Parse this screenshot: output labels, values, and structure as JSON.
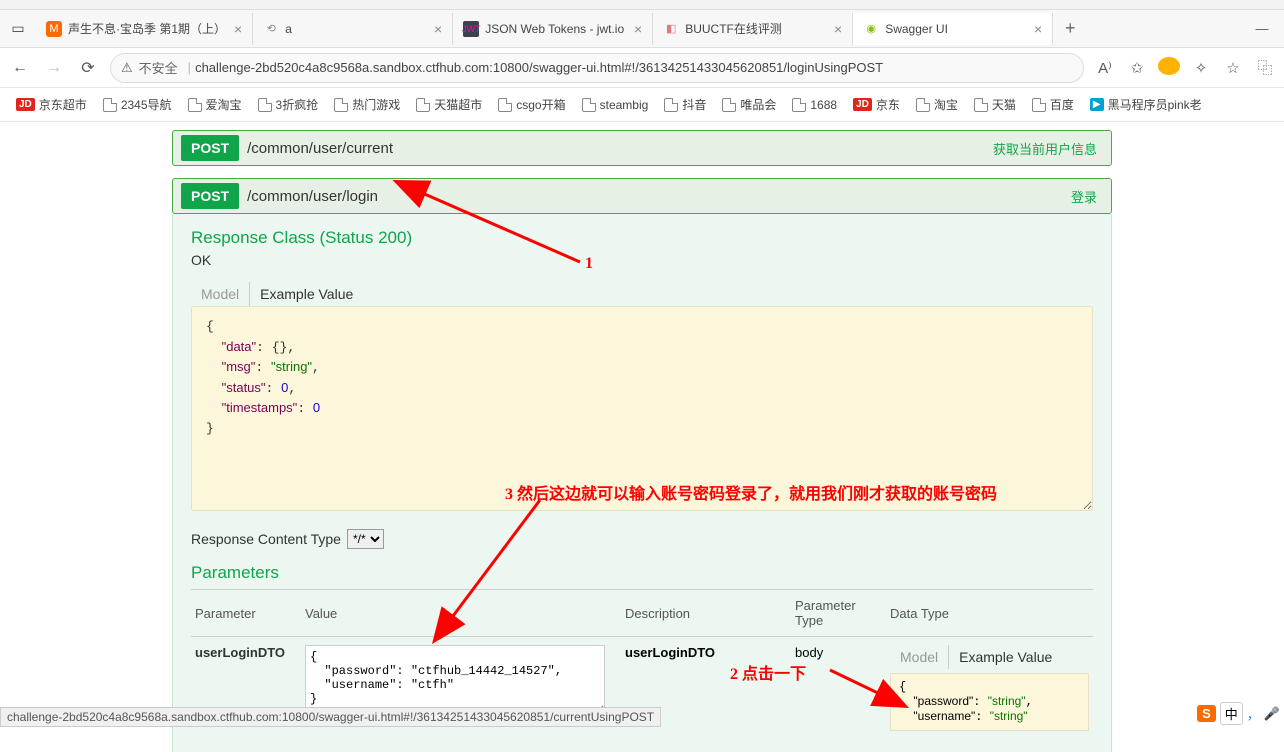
{
  "browser": {
    "tabs": [
      {
        "title": "声生不息·宝岛季 第1期（上）",
        "favicon_bg": "#ff6a00",
        "favicon_text": "M"
      },
      {
        "title": "a",
        "favicon_bg": "#dcdcdc",
        "favicon_text": "⟲"
      },
      {
        "title": "JSON Web Tokens - jwt.io",
        "favicon_bg": "#3b4151",
        "favicon_text": "J"
      },
      {
        "title": "BUUCTF在线评测",
        "favicon_bg": "#ffe0e0",
        "favicon_text": "B"
      },
      {
        "title": "Swagger UI",
        "favicon_bg": "#89bf04",
        "favicon_text": "◉",
        "active": true
      }
    ],
    "security_label": "不安全",
    "url": "challenge-2bd520c4a8c9568a.sandbox.ctfhub.com:10800/swagger-ui.html#!/3613425143304​5620851/loginUsingPOST",
    "bookmarks": [
      {
        "label": "京东超市",
        "badge": "JD"
      },
      {
        "label": "2345导航",
        "icon": "page"
      },
      {
        "label": "爱淘宝",
        "icon": "page"
      },
      {
        "label": "3折疯抢",
        "icon": "page"
      },
      {
        "label": "热门游戏",
        "icon": "page"
      },
      {
        "label": "天猫超市",
        "icon": "page"
      },
      {
        "label": "csgo开箱",
        "icon": "page"
      },
      {
        "label": "steambig",
        "icon": "page"
      },
      {
        "label": "抖音",
        "icon": "page"
      },
      {
        "label": "唯品会",
        "icon": "page"
      },
      {
        "label": "1688",
        "icon": "page"
      },
      {
        "label": "京东",
        "badge": "JD"
      },
      {
        "label": "淘宝",
        "icon": "page"
      },
      {
        "label": "天猫",
        "icon": "page"
      },
      {
        "label": "百度",
        "icon": "page"
      },
      {
        "label": "黑马程序员pink老",
        "badge_bili": "▶"
      }
    ]
  },
  "swagger": {
    "op1": {
      "method": "POST",
      "path": "/common/user/current",
      "desc": "获取当前用户信息"
    },
    "op2": {
      "method": "POST",
      "path": "/common/user/login",
      "desc": "登录"
    },
    "response_class": "Response Class (Status 200)",
    "ok": "OK",
    "tab_model": "Model",
    "tab_example": "Example Value",
    "example_json": "{\n  \"data\": {},\n  \"msg\": \"string\",\n  \"status\": 0,\n  \"timestamps\": 0\n}",
    "content_type_label": "Response Content Type",
    "content_type_value": "*/*",
    "params_title": "Parameters",
    "th_param": "Parameter",
    "th_value": "Value",
    "th_desc": "Description",
    "th_ptype": "Parameter\nType",
    "th_dtype": "Data Type",
    "param_name": "userLoginDTO",
    "param_value": "{\n  \"password\": \"ctfhub_14442_14527\",\n  \"username\": \"ctfh\"\n}",
    "param_desc": "userLoginDTO",
    "param_type": "body",
    "dtype_tab_model": "Model",
    "dtype_tab_example": "Example Value",
    "dtype_example": "{\n  \"password\": \"string\",\n  \"username\": \"string\""
  },
  "annotations": {
    "a1": "1",
    "a2": "2 点击一下",
    "a3": "3 然后这边就可以输入账号密码登录了，就用我们刚才获取的账号密码"
  },
  "status_bar": "challenge-2bd520c4a8c9568a.sandbox.ctfhub.com:10800/swagger-ui.html#!/36134251433045620851/currentUsingPOST",
  "ime": {
    "s": "S",
    "zhong": "中"
  }
}
